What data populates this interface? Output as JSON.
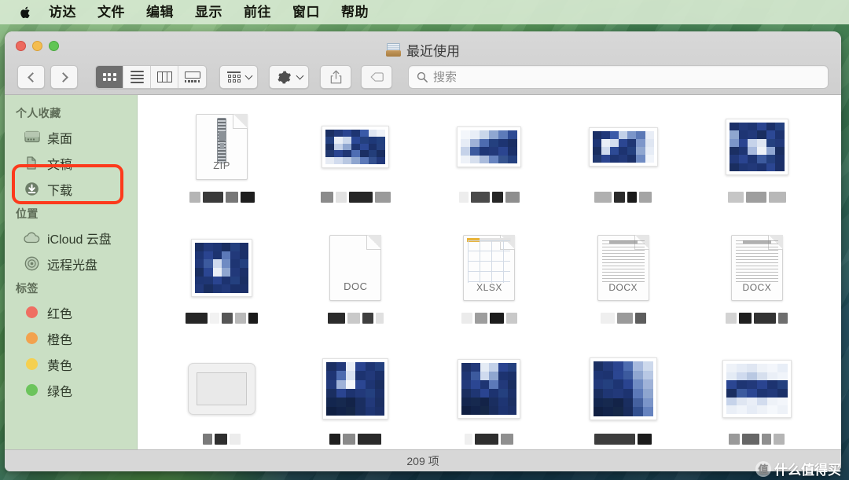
{
  "menubar": {
    "apple_icon": "apple-logo-icon",
    "items": [
      "访达",
      "文件",
      "编辑",
      "显示",
      "前往",
      "窗口",
      "帮助"
    ]
  },
  "window": {
    "title": "最近使用",
    "title_icon": "recents-clock-icon",
    "traffic_lights": [
      "close",
      "minimize",
      "zoom"
    ]
  },
  "toolbar": {
    "back_label": "back-arrow-icon",
    "forward_label": "forward-arrow-icon",
    "view_modes": [
      {
        "name": "icon-view",
        "icon": "grid-dots-icon",
        "active": true
      },
      {
        "name": "list-view",
        "icon": "list-lines-icon",
        "active": false
      },
      {
        "name": "column-view",
        "icon": "columns-icon",
        "active": false
      },
      {
        "name": "gallery-view",
        "icon": "gallery-icon",
        "active": false
      }
    ],
    "group_button": {
      "icon": "group-by-icon",
      "chevron": "chevron-down-icon"
    },
    "action_button": {
      "icon": "gear-icon",
      "chevron": "chevron-down-icon"
    },
    "share_button": {
      "icon": "share-icon"
    },
    "tag_button": {
      "icon": "tag-icon"
    }
  },
  "search": {
    "icon": "search-icon",
    "placeholder": "搜索",
    "value": ""
  },
  "sidebar": {
    "sections": [
      {
        "header": "个人收藏",
        "items": [
          {
            "label": "桌面",
            "icon": "desktop-icon",
            "highlighted": false
          },
          {
            "label": "文稿",
            "icon": "documents-icon",
            "highlighted": false
          },
          {
            "label": "下载",
            "icon": "downloads-icon",
            "highlighted": true
          }
        ]
      },
      {
        "header": "位置",
        "items": [
          {
            "label": "iCloud 云盘",
            "icon": "icloud-icon",
            "highlighted": false
          },
          {
            "label": "远程光盘",
            "icon": "remote-disc-icon",
            "highlighted": false
          }
        ]
      },
      {
        "header": "标签",
        "items": [
          {
            "label": "红色",
            "icon": "tag-dot-icon",
            "color": "#ef6f62"
          },
          {
            "label": "橙色",
            "icon": "tag-dot-icon",
            "color": "#f2a24e"
          },
          {
            "label": "黄色",
            "icon": "tag-dot-icon",
            "color": "#f5d04f"
          },
          {
            "label": "绿色",
            "icon": "tag-dot-icon",
            "color": "#6cc45c"
          }
        ]
      }
    ],
    "highlight_color": "#fc3a1c"
  },
  "content": {
    "files": [
      {
        "kind": "zip",
        "ext": "ZIP",
        "name_redacted": true
      },
      {
        "kind": "image",
        "ext": "",
        "name_redacted": true
      },
      {
        "kind": "image",
        "ext": "",
        "name_redacted": true
      },
      {
        "kind": "image",
        "ext": "",
        "name_redacted": true
      },
      {
        "kind": "image",
        "ext": "",
        "name_redacted": true
      },
      {
        "kind": "image",
        "ext": "",
        "name_redacted": true
      },
      {
        "kind": "doc",
        "ext": "DOC",
        "name_redacted": true
      },
      {
        "kind": "xlsx",
        "ext": "XLSX",
        "name_redacted": true
      },
      {
        "kind": "docx",
        "ext": "DOCX",
        "name_redacted": true
      },
      {
        "kind": "docx",
        "ext": "DOCX",
        "name_redacted": true
      },
      {
        "kind": "window",
        "ext": "",
        "name_redacted": true
      },
      {
        "kind": "image",
        "ext": "",
        "name_redacted": true
      },
      {
        "kind": "image",
        "ext": "",
        "name_redacted": true
      },
      {
        "kind": "image",
        "ext": "",
        "name_redacted": true
      },
      {
        "kind": "image",
        "ext": "",
        "name_redacted": true
      }
    ]
  },
  "statusbar": {
    "item_count": "209 项"
  },
  "watermark": {
    "logo": "值",
    "text": "什么值得买"
  }
}
